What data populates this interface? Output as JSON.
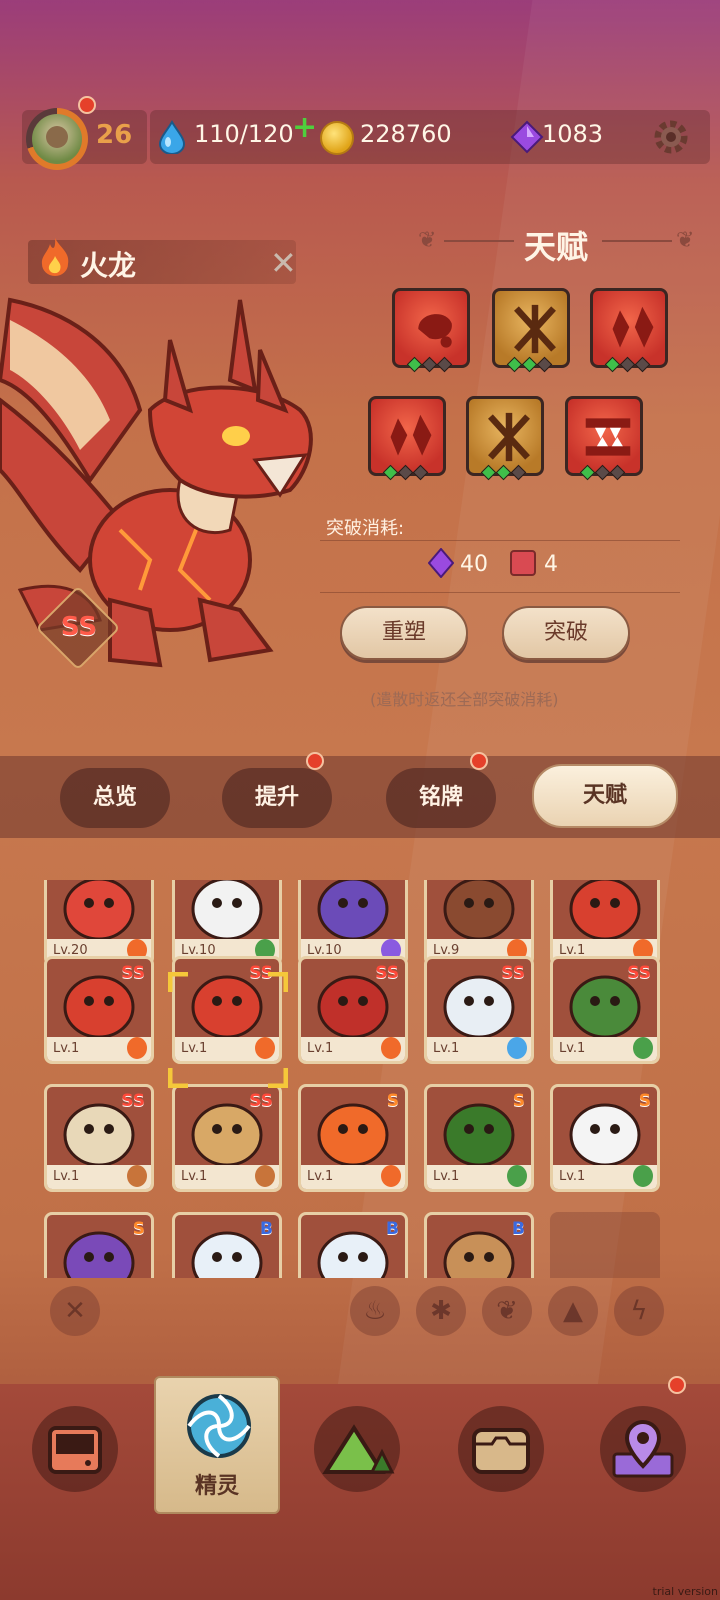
{
  "topbar": {
    "player_level": "26",
    "stamina": "110/120",
    "coins": "228760",
    "gems": "1083"
  },
  "pet": {
    "name": "火龙",
    "rank": "SS"
  },
  "talent_panel": {
    "title": "天赋",
    "cost_label": "突破消耗:",
    "cost_gems": "40",
    "cost_books": "4",
    "reshape_label": "重塑",
    "breakthrough_label": "突破",
    "note": "(遣散时返还全部突破消耗)",
    "talents": [
      {
        "icon": "claw-blood-icon",
        "style": "red",
        "stars": [
          1,
          0,
          0
        ]
      },
      {
        "icon": "cross-slash-icon",
        "style": "gold",
        "stars": [
          1,
          1,
          0
        ]
      },
      {
        "icon": "flame-shards-icon",
        "style": "red",
        "stars": [
          1,
          0,
          0
        ]
      },
      {
        "icon": "flame-shards-icon",
        "style": "red",
        "stars": [
          1,
          0,
          0
        ]
      },
      {
        "icon": "cross-slash-icon",
        "style": "gold",
        "stars": [
          1,
          1,
          0
        ]
      },
      {
        "icon": "fang-bite-icon",
        "style": "red",
        "stars": [
          1,
          0,
          0
        ]
      }
    ]
  },
  "tabs": [
    {
      "label": "总览",
      "dot": false
    },
    {
      "label": "提升",
      "dot": true
    },
    {
      "label": "铭牌",
      "dot": true
    },
    {
      "label": "天赋",
      "dot": false,
      "active": true
    }
  ],
  "pets_grid": [
    {
      "lv": "Lv.20",
      "grade": "",
      "element": "fire",
      "color": "#e0473a"
    },
    {
      "lv": "Lv.10",
      "grade": "",
      "element": "leaf",
      "color": "#f2f2f2"
    },
    {
      "lv": "Lv.10",
      "grade": "",
      "element": "bolt",
      "color": "#6b4bb8"
    },
    {
      "lv": "Lv.9",
      "grade": "",
      "element": "fire",
      "color": "#8a4a30"
    },
    {
      "lv": "Lv.1",
      "grade": "",
      "element": "fire",
      "color": "#d8402f"
    },
    {
      "lv": "Lv.1",
      "grade": "SS",
      "element": "fire",
      "color": "#d8402f"
    },
    {
      "lv": "Lv.1",
      "grade": "SS",
      "element": "fire",
      "color": "#d8402f"
    },
    {
      "lv": "Lv.1",
      "grade": "SS",
      "element": "fire",
      "color": "#c0302a"
    },
    {
      "lv": "Lv.1",
      "grade": "SS",
      "element": "frost",
      "color": "#e8eef4"
    },
    {
      "lv": "Lv.1",
      "grade": "SS",
      "element": "leaf",
      "color": "#4a8a3a"
    },
    {
      "lv": "Lv.1",
      "grade": "SS",
      "element": "earth",
      "color": "#e8d8b8"
    },
    {
      "lv": "Lv.1",
      "grade": "SS",
      "element": "earth",
      "color": "#d8a866"
    },
    {
      "lv": "Lv.1",
      "grade": "S",
      "element": "fire",
      "color": "#f06a2a"
    },
    {
      "lv": "Lv.1",
      "grade": "S",
      "element": "leaf",
      "color": "#3a7a2a"
    },
    {
      "lv": "Lv.1",
      "grade": "S",
      "element": "leaf",
      "color": "#f4f4f4"
    },
    {
      "lv": "",
      "grade": "S",
      "element": "",
      "color": "#7a4ab8"
    },
    {
      "lv": "",
      "grade": "B",
      "element": "",
      "color": "#e8f0f8"
    },
    {
      "lv": "",
      "grade": "B",
      "element": "",
      "color": "#e8f0f8"
    },
    {
      "lv": "",
      "grade": "B",
      "element": "",
      "color": "#c89058"
    }
  ],
  "filters": [
    "clear",
    "fire",
    "frost",
    "leaf",
    "earth",
    "bolt"
  ],
  "bottom_nav": {
    "active_label": "精灵",
    "items": [
      "battle",
      "spirit",
      "map",
      "chest",
      "location"
    ]
  },
  "watermark": "trial version"
}
